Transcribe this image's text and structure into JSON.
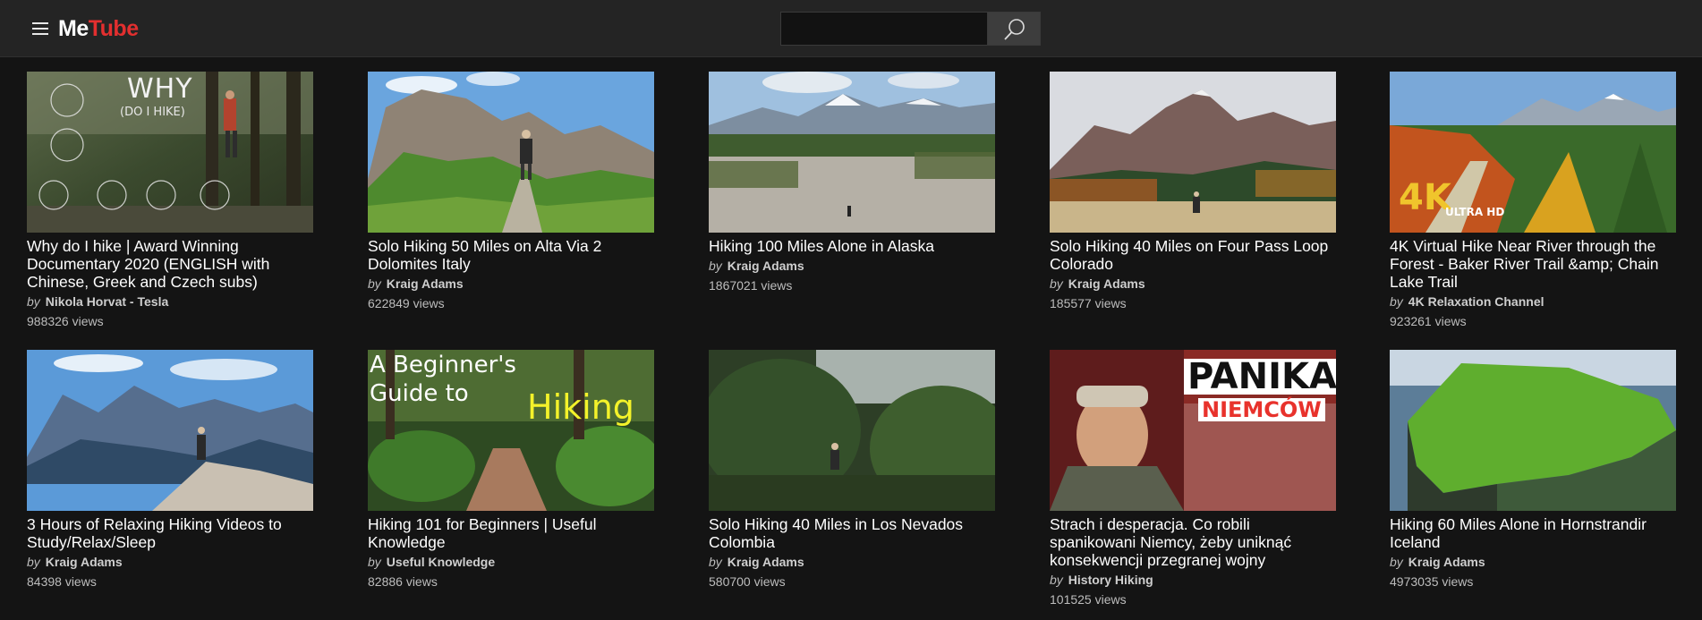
{
  "header": {
    "logo_me": "Me",
    "logo_tube": "Tube",
    "search_placeholder": "",
    "search_value": ""
  },
  "videos": [
    {
      "title": "Why do I hike | Award Winning Documentary 2020 (ENGLISH with Chinese, Greek and Czech subs)",
      "by": "by",
      "channel": "Nikola Horvat - Tesla",
      "views": "988326 views",
      "thumb_text": "WHY",
      "thumb_subtext": "(DO I HIKE)"
    },
    {
      "title": "Solo Hiking 50 Miles on Alta Via 2 Dolomites Italy",
      "by": "by",
      "channel": "Kraig Adams",
      "views": "622849 views"
    },
    {
      "title": "Hiking 100 Miles Alone in Alaska",
      "by": "by",
      "channel": "Kraig Adams",
      "views": "1867021 views"
    },
    {
      "title": "Solo Hiking 40 Miles on Four Pass Loop Colorado",
      "by": "by",
      "channel": "Kraig Adams",
      "views": "185577 views"
    },
    {
      "title": "4K Virtual Hike Near River through the Forest - Baker River Trail &amp; Chain Lake Trail",
      "by": "by",
      "channel": "4K Relaxation Channel",
      "views": "923261 views",
      "thumb_text": "4K",
      "thumb_subtext": "ULTRA HD"
    },
    {
      "title": "3 Hours of Relaxing Hiking Videos to Study/Relax/Sleep",
      "by": "by",
      "channel": "Kraig Adams",
      "views": "84398 views"
    },
    {
      "title": "Hiking 101 for Beginners | Useful Knowledge",
      "by": "by",
      "channel": "Useful Knowledge",
      "views": "82886 views",
      "thumb_text": "A Beginner's",
      "thumb_subtext": "Guide to",
      "thumb_text3": "Hiking"
    },
    {
      "title": "Solo Hiking 40 Miles in Los Nevados Colombia",
      "by": "by",
      "channel": "Kraig Adams",
      "views": "580700 views"
    },
    {
      "title": "Strach i desperacja. Co robili spanikowani Niemcy, żeby uniknąć konsekwencji przegranej wojny",
      "by": "by",
      "channel": "History Hiking",
      "views": "101525 views",
      "thumb_text": "PANIKA",
      "thumb_subtext": "NIEMCÓW"
    },
    {
      "title": "Hiking 60 Miles Alone in Hornstrandir Iceland",
      "by": "by",
      "channel": "Kraig Adams",
      "views": "4973035 views"
    }
  ],
  "colors": {
    "background": "#141414",
    "topbar": "#242424",
    "logo_accent": "#e32f2f"
  },
  "icons": {
    "menu": "hamburger-icon",
    "search": "search-icon"
  }
}
